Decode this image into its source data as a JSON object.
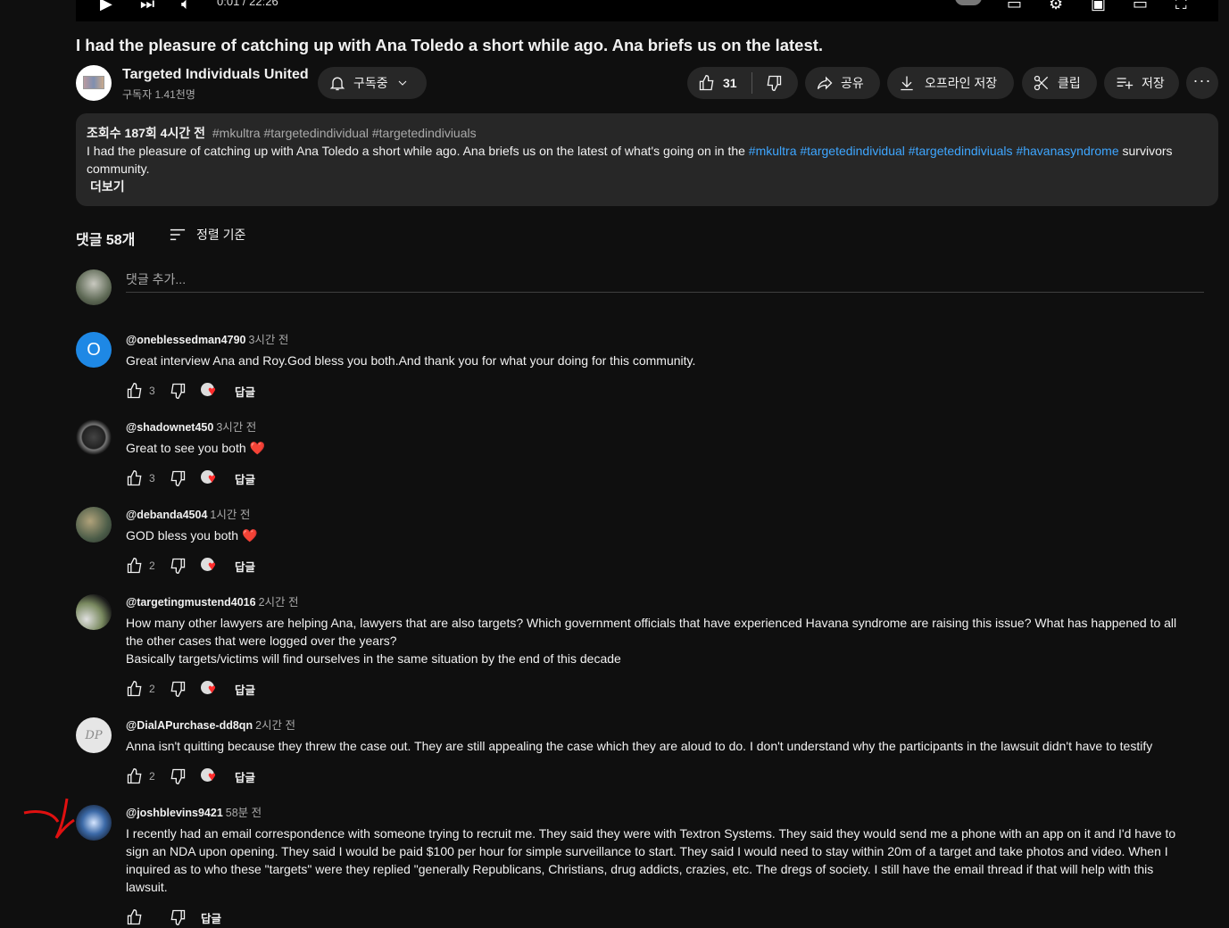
{
  "player": {
    "time": "0:01 / 22:26"
  },
  "video": {
    "title": "I had the pleasure of catching up with Ana Toledo a short while ago. Ana briefs us on the latest.",
    "channel_name": "Targeted Individuals United",
    "subscribers": "구독자 1.41천명"
  },
  "actions": {
    "subscribe_label": "구독중",
    "like_count": "31",
    "share_label": "공유",
    "download_label": "오프라인 저장",
    "clip_label": "클립",
    "save_label": "저장"
  },
  "description": {
    "views_time": "조회수 187회  4시간 전",
    "tags": "#mkultra #targetedindividual #targetedindiviuals",
    "text_before": "I had the pleasure of catching up with Ana Toledo a short while ago. Ana briefs us on the latest of what's going on in the ",
    "hashtags": [
      "#mkultra",
      "#targetedindividual",
      "#targetedindiviuals",
      "#havanasyndrome"
    ],
    "text_after": " survivors community.",
    "more_label": "더보기"
  },
  "comments_section": {
    "count_label": "댓글 58개",
    "sort_label": "정렬 기준",
    "add_placeholder": "댓글 추가...",
    "reply_label": "답글"
  },
  "comments": [
    {
      "author": "@oneblessedman4790",
      "time": "3시간 전",
      "text": "Great interview Ana and Roy.God bless you both.And thank you for what your doing for this community.",
      "likes": "3",
      "avatar_letter": "O"
    },
    {
      "author": "@shadownet450",
      "time": "3시간 전",
      "text": "Great to see you both ❤️",
      "likes": "3"
    },
    {
      "author": "@debanda4504",
      "time": "1시간 전",
      "text": "GOD bless you both ❤️",
      "likes": "2"
    },
    {
      "author": "@targetingmustend4016",
      "time": "2시간 전",
      "text": "How many other lawyers are helping Ana, lawyers that are also targets? Which government officials that have experienced Havana syndrome are raising this issue? What has happened to all the other cases that were logged over the years?\nBasically targets/victims will find ourselves in the same situation by the end of this decade",
      "likes": "2"
    },
    {
      "author": "@DialAPurchase-dd8qn",
      "time": "2시간 전",
      "text": "Anna isn't quitting because they threw the case out. They are still appealing the case which they are aloud to do. I don't understand why the participants in the lawsuit didn't have to testify",
      "likes": "2",
      "avatar_letter": "DP"
    },
    {
      "author": "@joshblevins9421",
      "time": "58분 전",
      "text": "I recently had an email correspondence with someone trying to recruit me. They said they were with Textron Systems. They said they would send me a phone with an app on it and I'd have to sign an NDA upon opening. They said I would be paid $100 per hour for simple surveillance to start. They said I would need to stay within 20m of a target and take photos and video. When I inquired as to who these \"targets\" were they replied \"generally Republicans, Christians, drug addicts, crazies, etc. The dregs of society. I still have the email thread if that will help with this lawsuit.",
      "likes": ""
    }
  ]
}
